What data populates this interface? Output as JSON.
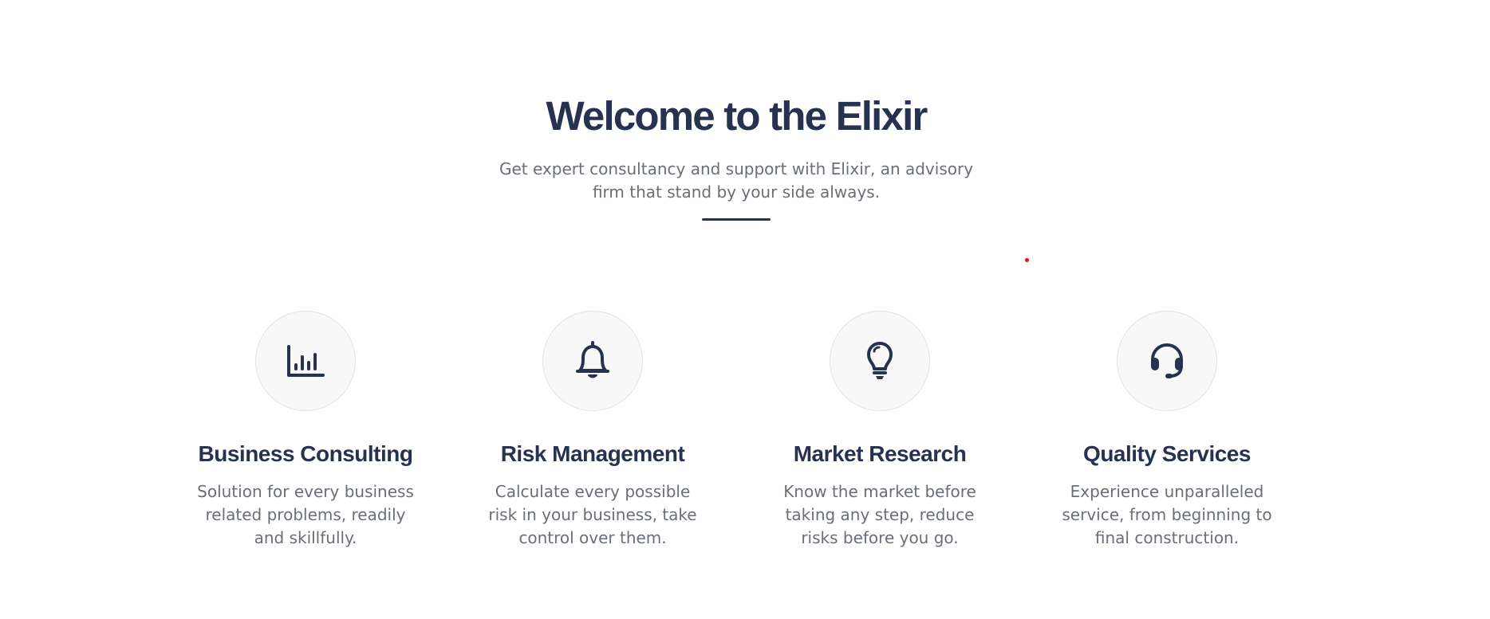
{
  "hero": {
    "title": "Welcome to the Elixir",
    "subtitle": "Get expert consultancy and support with Elixir, an advisory firm that stand by your side always."
  },
  "services": [
    {
      "icon": "bar-chart-icon",
      "title": "Business Consulting",
      "description": "Solution for every business related problems, readily and skillfully."
    },
    {
      "icon": "bell-icon",
      "title": "Risk Management",
      "description": "Calculate every possible risk in your business, take control over them."
    },
    {
      "icon": "lightbulb-icon",
      "title": "Market Research",
      "description": "Know the market before taking any step, reduce risks before you go."
    },
    {
      "icon": "headset-icon",
      "title": "Quality Services",
      "description": "Experience unparalleled service, from beginning to final construction."
    }
  ],
  "colors": {
    "heading": "#26324f",
    "text": "#6a6e76",
    "icon_circle": "#f8f8f8",
    "marker_dot": "#e10f1f"
  }
}
